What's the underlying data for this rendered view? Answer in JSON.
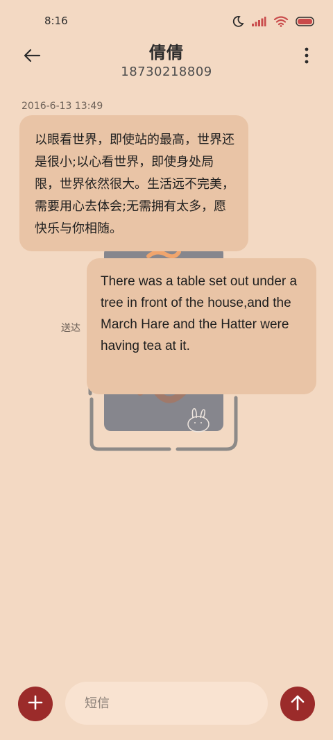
{
  "status_bar": {
    "time": "8:16",
    "icons": [
      "moon-icon",
      "signal-icon",
      "wifi-icon",
      "battery-icon"
    ],
    "battery_color": "#c94b4b"
  },
  "header": {
    "contact_name": "倩倩",
    "contact_number": "18730218809",
    "back_icon": "back-arrow-icon",
    "more_icon": "more-vertical-icon"
  },
  "conversation": {
    "timestamp": "2016-6-13 13:49",
    "incoming": {
      "text": "以眼看世界，即使站的最高，世界还是很小;以心看世界，即使身处局限，世界依然很大。生活远不完美，需要用心去体会;无需拥有太多，愿快乐与你相随。"
    },
    "sent_status": "送达",
    "outgoing": {
      "text": "There was a table set out under a tree in front of the house,and the March Hare and the Hatter were having tea at it."
    }
  },
  "composer": {
    "placeholder": "短信",
    "value": "",
    "add_icon": "plus-icon",
    "send_icon": "arrow-up-icon",
    "accent_color": "#9b2b2a"
  },
  "theme": {
    "background": "#f3d9c3",
    "bubble_color": "#e9c4a6",
    "input_background": "#f9e3d1"
  }
}
